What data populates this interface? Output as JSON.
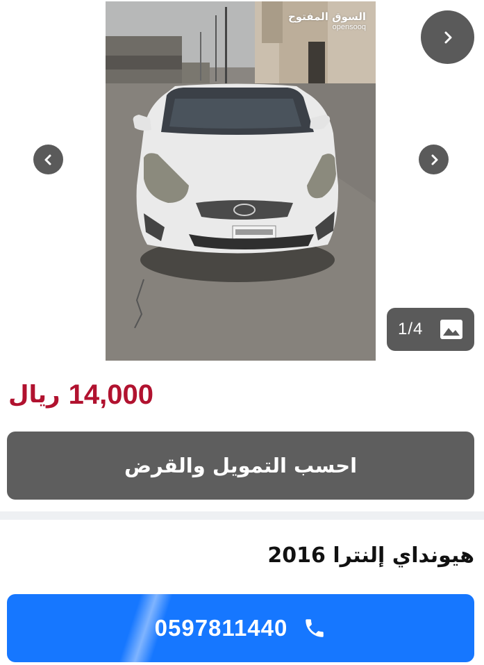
{
  "gallery": {
    "watermark_ar": "السوق المفتوح",
    "watermark_en": "opensooq",
    "counter": "1/4",
    "icons": {
      "next_top": "chevron-right-icon",
      "prev": "chevron-left-icon",
      "next": "chevron-right-icon",
      "gallery": "image-icon"
    }
  },
  "listing": {
    "price_value": "14,000",
    "price_currency": "ريال",
    "finance_button_label": "احسب التمويل والقرض",
    "title": "هيونداي إلنترا 2016"
  },
  "contact": {
    "phone": "0597811440",
    "icon": "phone-icon"
  },
  "colors": {
    "price": "#b1122f",
    "button_gray": "#5e5e5e",
    "call_blue": "#1677ff",
    "nav_gray": "#5a5a5a"
  }
}
